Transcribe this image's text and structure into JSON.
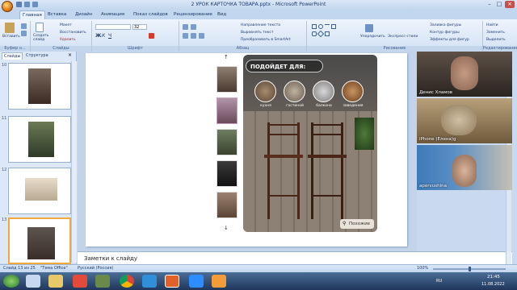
{
  "window": {
    "title": "2 УРОК КАРТОЧКА ТОВАРА.pptx - Microsoft PowerPoint"
  },
  "tabs": [
    "Главная",
    "Вставка",
    "Дизайн",
    "Анимация",
    "Показ слайдов",
    "Рецензирование",
    "Вид"
  ],
  "ribbon": {
    "clipboard": {
      "paste": "Вставить",
      "label": "Буфер о..."
    },
    "slides": {
      "new_slide": "Создать слайд",
      "layout": "Макет",
      "reset": "Восстановить",
      "delete": "Удалить",
      "label": "Слайды"
    },
    "font": {
      "label": "Шрифт",
      "size": "32"
    },
    "paragraph": {
      "text_direction": "Направление текста",
      "align_text": "Выровнять текст",
      "smartart": "Преобразовать в SmartArt",
      "label": "Абзац"
    },
    "drawing": {
      "arrange": "Упорядочить",
      "quick_styles": "Экспресс-стили",
      "fill": "Заливка фигуры",
      "outline": "Контур фигуры",
      "effects": "Эффекты для фигур",
      "label": "Рисование"
    },
    "editing": {
      "find": "Найти",
      "replace": "Заменить",
      "select": "Выделить",
      "label": "Редактирование"
    }
  },
  "panel": {
    "tab_slides": "Слайды",
    "tab_outline": "Структура",
    "slide_numbers": [
      "10",
      "11",
      "12",
      "13"
    ]
  },
  "card": {
    "heading": "ПОДОЙДЕТ ДЛЯ:",
    "categories": [
      "кухня",
      "гостиной",
      "балкона",
      "заведения"
    ],
    "badge": "Похожие"
  },
  "notes": {
    "placeholder": "Заметки к слайду"
  },
  "status": {
    "slide": "Слайд 13 из 25",
    "theme": "\"Тема Office\"",
    "language": "Русский (Россия)",
    "zoom": "100%"
  },
  "video": [
    {
      "name": "Денис Хламов"
    },
    {
      "name": "iPhone (Елена)g"
    },
    {
      "name": "apervushina"
    }
  ],
  "taskbar": {
    "lang": "RU",
    "time": "21:45",
    "date": "11.08.2022"
  },
  "colors": {
    "accent": "#c9daf0",
    "taskbar": "#20375b",
    "selected_thumb": "#f2a93b"
  }
}
